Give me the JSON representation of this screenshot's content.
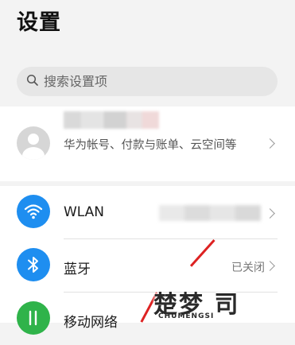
{
  "header": {
    "title": "设置"
  },
  "search": {
    "placeholder": "搜索设置项",
    "icon": "search-icon"
  },
  "account": {
    "description": "华为帐号、付款与账单、云空间等",
    "avatar_icon": "person-icon"
  },
  "settings": {
    "items": [
      {
        "label": "WLAN",
        "value": "",
        "icon": "wifi-icon",
        "color": "#1e8ef0"
      },
      {
        "label": "蓝牙",
        "value": "已关闭",
        "icon": "bluetooth-icon",
        "color": "#1e8ef0"
      },
      {
        "label": "移动网络",
        "value": "",
        "icon": "mobile-network-icon",
        "color": "#2fb34a"
      }
    ]
  },
  "watermark": {
    "main": "楚梦 司",
    "sub": "CHUMENGSI"
  },
  "annotation": {
    "arrow_color": "#dd2222"
  }
}
